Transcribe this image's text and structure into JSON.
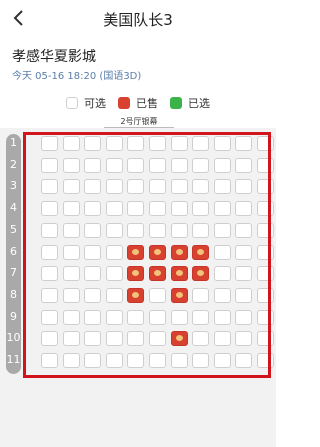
{
  "header": {
    "back_icon": "chevron-left-icon",
    "title": "美国队长3"
  },
  "cinema": {
    "name": "孝感华夏影城",
    "showtime": "今天 05-16  18:20 (国语3D)"
  },
  "legend": [
    {
      "label": "可选",
      "status": "available"
    },
    {
      "label": "已售",
      "status": "sold"
    },
    {
      "label": "已选",
      "status": "selected"
    }
  ],
  "screen_label": "2号厅银幕",
  "colors": {
    "sold": "#d8412f",
    "selected": "#3cb34a",
    "frame": "#d2141c"
  },
  "row_labels": [
    "1",
    "2",
    "3",
    "4",
    "5",
    "6",
    "7",
    "8",
    "9",
    "10",
    "11"
  ],
  "seat_columns": 11,
  "sold_seats": [
    {
      "row": 6,
      "col": 5
    },
    {
      "row": 6,
      "col": 6
    },
    {
      "row": 6,
      "col": 7
    },
    {
      "row": 6,
      "col": 8
    },
    {
      "row": 7,
      "col": 5
    },
    {
      "row": 7,
      "col": 6
    },
    {
      "row": 7,
      "col": 7
    },
    {
      "row": 7,
      "col": 8
    },
    {
      "row": 8,
      "col": 5
    },
    {
      "row": 8,
      "col": 7
    },
    {
      "row": 10,
      "col": 7
    }
  ]
}
